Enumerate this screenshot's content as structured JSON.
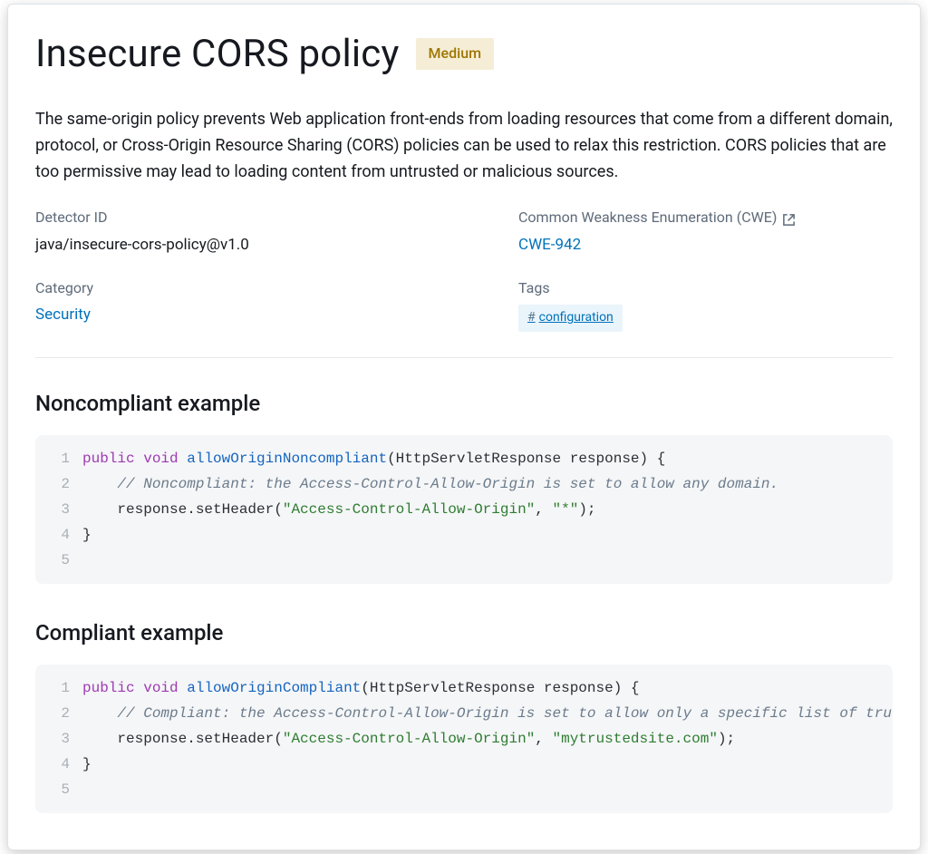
{
  "title": "Insecure CORS policy",
  "severity": "Medium",
  "description": "The same-origin policy prevents Web application front-ends from loading resources that come from a different domain, protocol, or Cross-Origin Resource Sharing (CORS) policies can be used to relax this restriction. CORS policies that are too permissive may lead to loading content from untrusted or malicious sources.",
  "detector_id_label": "Detector ID",
  "detector_id": "java/insecure-cors-policy@v1.0",
  "cwe_label": "Common Weakness Enumeration (CWE)",
  "cwe_link_text": "CWE-942",
  "category_label": "Category",
  "category_link_text": "Security",
  "tags_label": "Tags",
  "tag_prefix": "#",
  "tag_text": "configuration",
  "sections": {
    "noncompliant_heading": "Noncompliant example",
    "compliant_heading": "Compliant example"
  },
  "noncompliant": {
    "lines": [
      {
        "n": "1",
        "tok": [
          {
            "c": "kw1",
            "t": "public"
          },
          {
            "c": "",
            "t": " "
          },
          {
            "c": "kw1",
            "t": "void"
          },
          {
            "c": "",
            "t": " "
          },
          {
            "c": "fn",
            "t": "allowOriginNoncompliant"
          },
          {
            "c": "",
            "t": "(HttpServletResponse response) {"
          }
        ]
      },
      {
        "n": "2",
        "tok": [
          {
            "c": "",
            "t": "    "
          },
          {
            "c": "cmt",
            "t": "// Noncompliant: the Access-Control-Allow-Origin is set to allow any domain."
          }
        ]
      },
      {
        "n": "3",
        "tok": [
          {
            "c": "",
            "t": "    response.setHeader("
          },
          {
            "c": "str",
            "t": "\"Access-Control-Allow-Origin\""
          },
          {
            "c": "",
            "t": ", "
          },
          {
            "c": "str",
            "t": "\"*\""
          },
          {
            "c": "",
            "t": ");"
          }
        ]
      },
      {
        "n": "4",
        "tok": [
          {
            "c": "",
            "t": "}"
          }
        ]
      },
      {
        "n": "5",
        "tok": [
          {
            "c": "",
            "t": ""
          }
        ]
      }
    ]
  },
  "compliant": {
    "lines": [
      {
        "n": "1",
        "tok": [
          {
            "c": "kw1",
            "t": "public"
          },
          {
            "c": "",
            "t": " "
          },
          {
            "c": "kw1",
            "t": "void"
          },
          {
            "c": "",
            "t": " "
          },
          {
            "c": "fn",
            "t": "allowOriginCompliant"
          },
          {
            "c": "",
            "t": "(HttpServletResponse response) {"
          }
        ]
      },
      {
        "n": "2",
        "tok": [
          {
            "c": "",
            "t": "    "
          },
          {
            "c": "cmt",
            "t": "// Compliant: the Access-Control-Allow-Origin is set to allow only a specific list of trusted domains."
          }
        ]
      },
      {
        "n": "3",
        "tok": [
          {
            "c": "",
            "t": "    response.setHeader("
          },
          {
            "c": "str",
            "t": "\"Access-Control-Allow-Origin\""
          },
          {
            "c": "",
            "t": ", "
          },
          {
            "c": "str",
            "t": "\"mytrustedsite.com\""
          },
          {
            "c": "",
            "t": ");"
          }
        ]
      },
      {
        "n": "4",
        "tok": [
          {
            "c": "",
            "t": "}"
          }
        ]
      },
      {
        "n": "5",
        "tok": [
          {
            "c": "",
            "t": ""
          }
        ]
      }
    ]
  }
}
